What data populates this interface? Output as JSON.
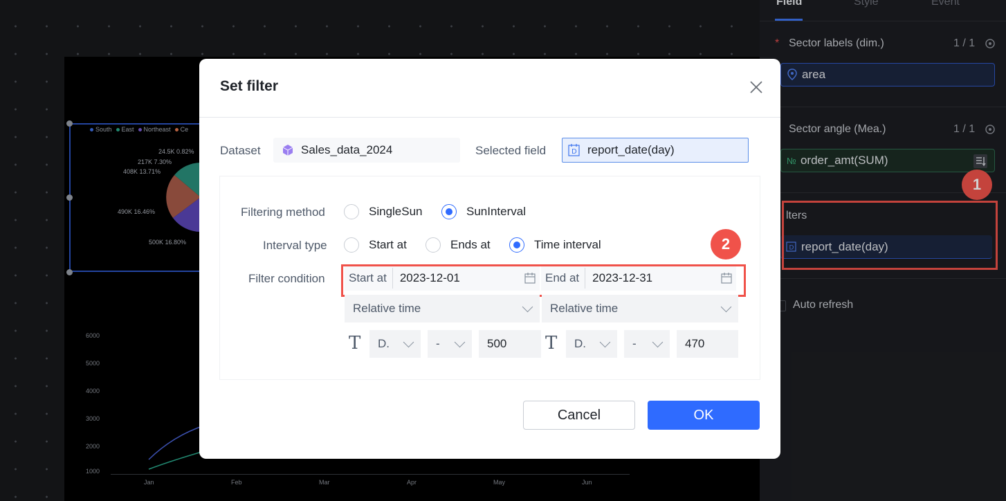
{
  "canvas": {
    "legend": [
      {
        "label": "South",
        "color": "#3f6fe0"
      },
      {
        "label": "East",
        "color": "#2aa98c"
      },
      {
        "label": "Northeast",
        "color": "#7b5cd6"
      },
      {
        "label": "Ce",
        "color": "#e07850"
      }
    ],
    "pie_labels": [
      "24.5K 0.82%",
      "217K 7.30%",
      "408K 13.71%",
      "490K 16.46%",
      "500K 16.80%"
    ],
    "line_y_ticks": [
      "6000",
      "5000",
      "4000",
      "3000",
      "2000",
      "1000"
    ],
    "line_x_ticks": [
      "Jan",
      "Feb",
      "Mar",
      "Apr",
      "May",
      "Jun"
    ]
  },
  "side": {
    "tabs": [
      "Field",
      "Style",
      "Event"
    ],
    "sector_labels_title": "Sector labels (dim.)",
    "sector_labels_count": "1 / 1",
    "sector_labels_field": "area",
    "sector_angle_title": "Sector angle (Mea.)",
    "sector_angle_count": "1 / 1",
    "sector_angle_field": "order_amt(SUM)",
    "measure_badge": "№",
    "filters_title": "lters",
    "filters_field": "report_date(day)",
    "auto_refresh": "Auto refresh"
  },
  "dialog": {
    "title": "Set filter",
    "dataset_label": "Dataset",
    "dataset_value": "Sales_data_2024",
    "selected_field_label": "Selected field",
    "selected_field_value": "report_date(day)",
    "filtering_method_label": "Filtering method",
    "method_options": [
      "SingleSun",
      "SunInterval"
    ],
    "interval_type_label": "Interval type",
    "interval_options": [
      "Start at",
      "Ends at",
      "Time interval"
    ],
    "filter_condition_label": "Filter condition",
    "start_label": "Start at",
    "start_value": "2023-12-01",
    "end_label": "End at",
    "end_value": "2023-12-31",
    "relative_left": "Relative time",
    "relative_right": "Relative time",
    "unit_left": "D.",
    "dash_left": "-",
    "num_left": "500",
    "unit_right": "D.",
    "dash_right": "-",
    "num_right": "470",
    "cancel_label": "Cancel",
    "ok_label": "OK"
  },
  "annotations": {
    "badge1": "1",
    "badge2": "2",
    "color": "#f0524a"
  }
}
